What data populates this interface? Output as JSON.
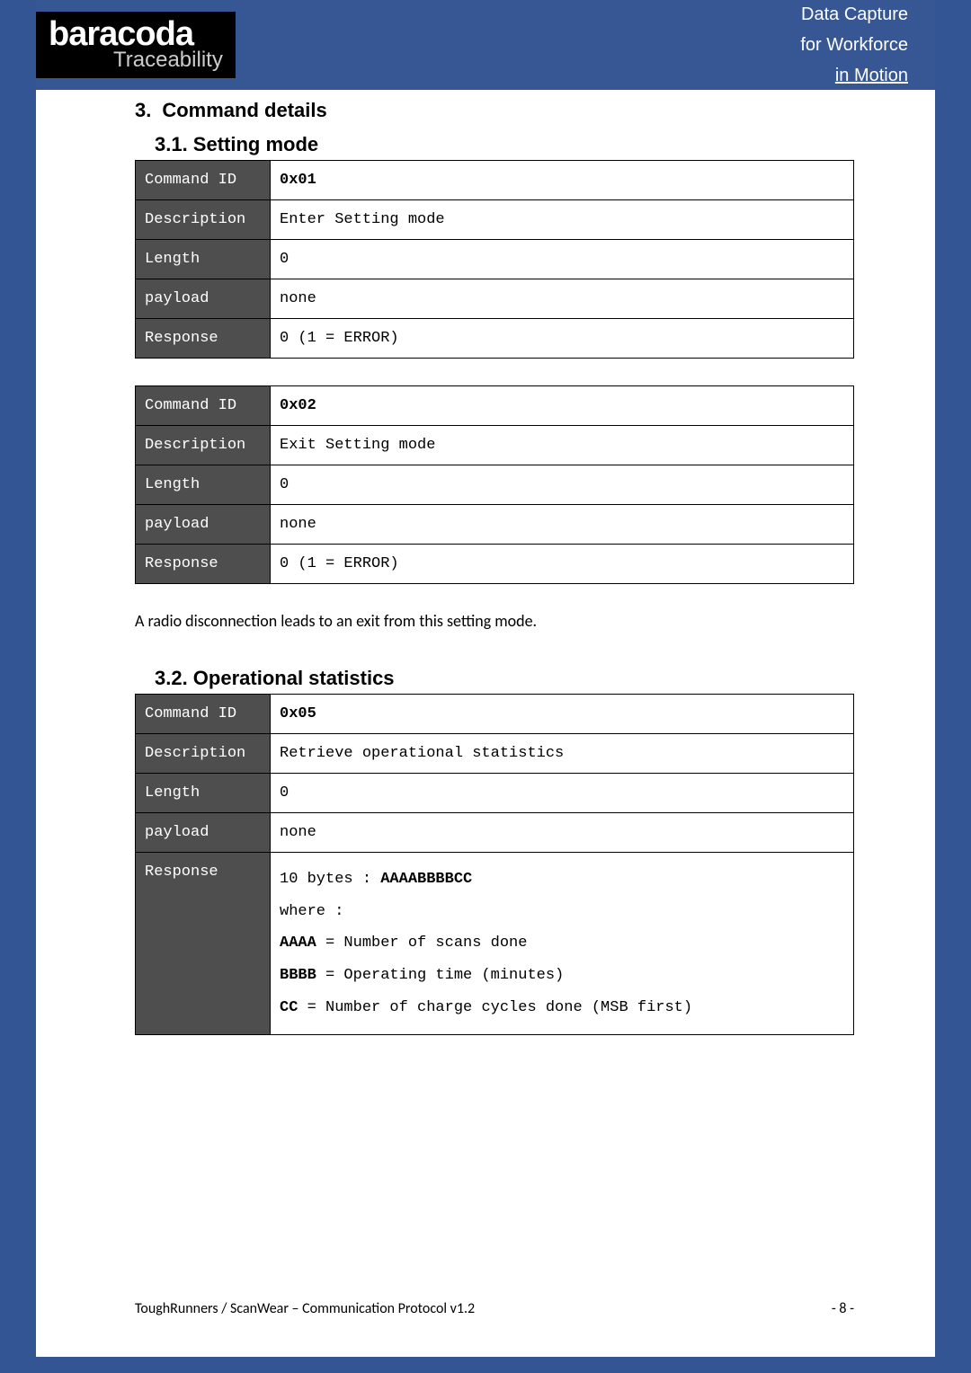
{
  "brand": {
    "name": "baracoda",
    "sub": "Traceability"
  },
  "tagline": {
    "line1": "Data Capture",
    "line2": "for Workforce",
    "line3": "in Motion"
  },
  "headings": {
    "num": "3.",
    "title": "Command details",
    "sub31": "3.1. Setting mode",
    "sub32": "3.2. Operational statistics"
  },
  "labels": {
    "command_id": "Command ID",
    "description": "Description",
    "length": "Length",
    "payload": "payload",
    "response": "Response"
  },
  "table1": {
    "command_id": "0x01",
    "description": "Enter Setting mode",
    "length": "0",
    "payload": "none",
    "response": "0 (1 = ERROR)"
  },
  "table2": {
    "command_id": "0x02",
    "description": "Exit Setting mode",
    "length": "0",
    "payload": "none",
    "response": "0 (1 = ERROR)"
  },
  "note": "A radio disconnection leads to an exit from this setting mode.",
  "table3": {
    "command_id": "0x05",
    "description": "Retrieve operational statistics",
    "length": "0",
    "payload": "none",
    "response_intro": "10 bytes : ",
    "response_code": "AAAABBBBCC",
    "where": "where :",
    "aaaa_label": "AAAA",
    "aaaa_text": " = Number of scans done",
    "bbbb_label": "BBBB",
    "bbbb_text": " = Operating time (minutes)",
    "cc_label": "CC",
    "cc_text": " = Number of charge cycles done (MSB first)"
  },
  "footer": {
    "left": "ToughRunners / ScanWear – Communication Protocol v1.2",
    "right": "- 8 -"
  }
}
